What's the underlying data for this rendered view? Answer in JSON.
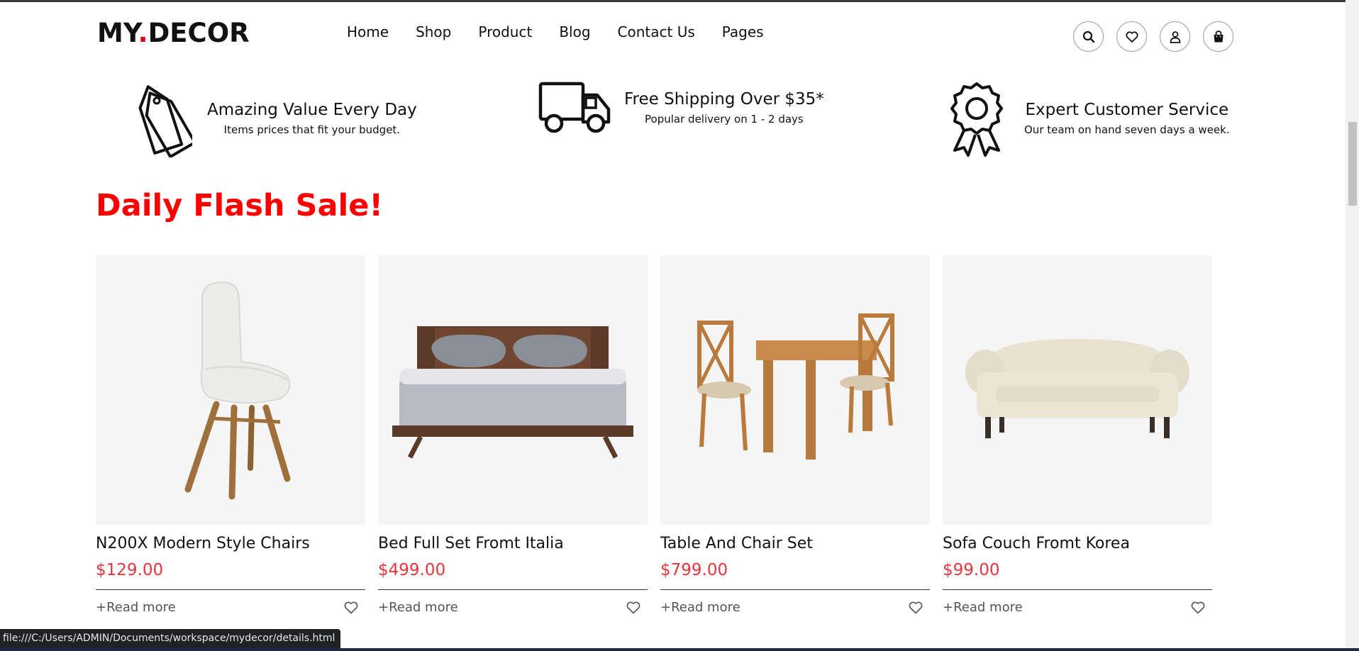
{
  "header": {
    "logo_main": "MY",
    "logo_dot": ".",
    "logo_rest": "DECOR",
    "nav": [
      "Home",
      "Shop",
      "Product",
      "Blog",
      "Contact Us",
      "Pages"
    ]
  },
  "features": [
    {
      "title": "Amazing Value Every Day",
      "subtitle": "Items prices that fit your budget.",
      "icon": "price-tag-icon"
    },
    {
      "title": "Free Shipping Over $35*",
      "subtitle": "Popular delivery on 1 - 2 days",
      "icon": "truck-icon"
    },
    {
      "title": "Expert Customer Service",
      "subtitle": "Our team on hand seven days a week.",
      "icon": "award-badge-icon"
    }
  ],
  "section_title": "Daily Flash Sale!",
  "products": [
    {
      "name": "N200X Modern Style Chairs",
      "price": "$129.00",
      "read_more": "+Read more",
      "image": "chair-image"
    },
    {
      "name": "Bed Full Set Fromt Italia",
      "price": "$499.00",
      "read_more": "+Read more",
      "image": "bed-image"
    },
    {
      "name": "Table And Chair Set",
      "price": "$799.00",
      "read_more": "+Read more",
      "image": "table-chairs-image"
    },
    {
      "name": "Sofa Couch Fromt Korea",
      "price": "$99.00",
      "read_more": "+Read more",
      "image": "sofa-image"
    }
  ],
  "status_url": "file:///C:/Users/ADMIN/Documents/workspace/mydecor/details.html",
  "colors": {
    "accent": "#ff0000",
    "price": "#e8343b",
    "logo_dot": "#e10019"
  }
}
